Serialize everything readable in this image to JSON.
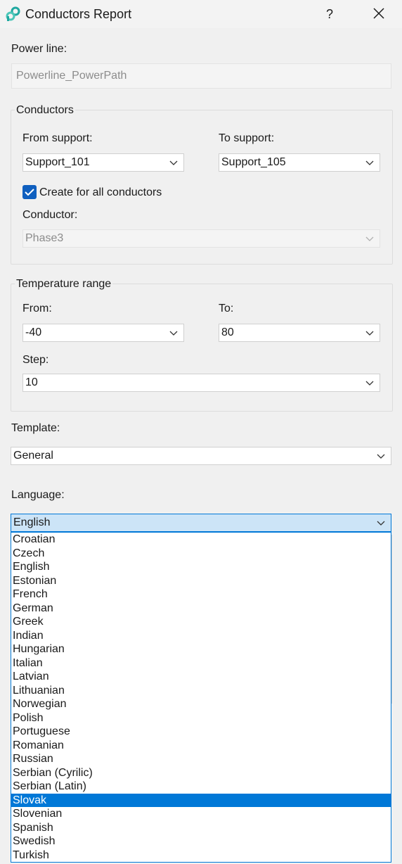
{
  "window": {
    "title": "Conductors Report",
    "help": "?"
  },
  "power_line": {
    "label": "Power line:",
    "value": "Powerline_PowerPath"
  },
  "conductors": {
    "group_title": "Conductors",
    "from_label": "From support:",
    "from_value": "Support_101",
    "to_label": "To support:",
    "to_value": "Support_105",
    "create_all_label": "Create for all conductors",
    "create_all_checked": true,
    "conductor_label": "Conductor:",
    "conductor_value": "Phase3"
  },
  "temperature": {
    "group_title": "Temperature range",
    "from_label": "From:",
    "from_value": "-40",
    "to_label": "To:",
    "to_value": "80",
    "step_label": "Step:",
    "step_value": "10"
  },
  "template": {
    "label": "Template:",
    "value": "General"
  },
  "language": {
    "label": "Language:",
    "value": "English",
    "options": [
      "Croatian",
      "Czech",
      "English",
      "Estonian",
      "French",
      "German",
      "Greek",
      "Indian",
      "Hungarian",
      "Italian",
      "Latvian",
      "Lithuanian",
      "Norwegian",
      "Polish",
      "Portuguese",
      "Romanian",
      "Russian",
      "Serbian (Cyrilic)",
      "Serbian (Latin)",
      "Slovak",
      "Slovenian",
      "Spanish",
      "Swedish",
      "Turkish"
    ],
    "highlighted": "Slovak"
  },
  "colors": {
    "accent": "#0078d7",
    "checkbox": "#0f5fbf",
    "icon": "#1fa8a0"
  },
  "icons": {
    "app": "app-logo-icon",
    "close": "close-icon",
    "chevron": "chevron-down-icon",
    "check": "checkmark-icon"
  }
}
